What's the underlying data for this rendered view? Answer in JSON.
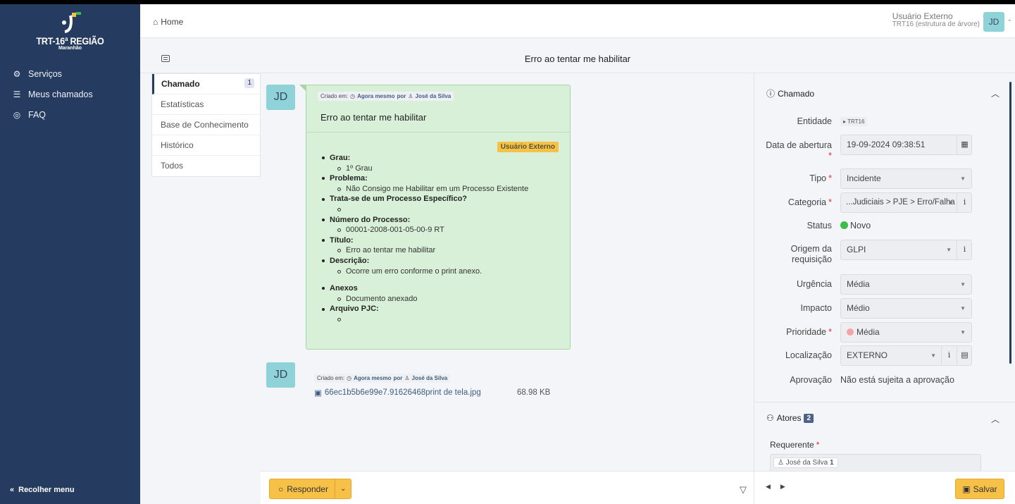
{
  "brand": {
    "title": "TRT-16ª REGIÃO",
    "subtitle": "Maranhão"
  },
  "sidebar": {
    "items": [
      {
        "label": "Serviços",
        "icon": "services-icon"
      },
      {
        "label": "Meus chamados",
        "icon": "list-icon"
      },
      {
        "label": "FAQ",
        "icon": "faq-icon"
      }
    ],
    "collapse_label": "Recolher menu"
  },
  "topbar": {
    "home_label": "Home",
    "user_name": "Usuário Externo",
    "user_entity": "TRT16 (estrutura de árvore)",
    "avatar_initials": "JD"
  },
  "ticket": {
    "title": "Erro ao tentar me habilitar"
  },
  "tabs": [
    {
      "label": "Chamado",
      "badge": "1"
    },
    {
      "label": "Estatísticas"
    },
    {
      "label": "Base de Conhecimento"
    },
    {
      "label": "Histórico"
    },
    {
      "label": "Todos"
    }
  ],
  "timeline": {
    "item1": {
      "avatar": "JD",
      "created_label": "Criado em:",
      "created_when": "Agora mesmo",
      "by_label": "por",
      "author": "José da Silva",
      "title": "Erro ao tentar me habilitar",
      "tag": "Usuário Externo",
      "fields": [
        {
          "key": "Grau:",
          "value": "1º Grau"
        },
        {
          "key": "Problema:",
          "value": "Não Consigo me Habilitar em um Processo Existente"
        },
        {
          "key": "Trata-se de um Processo Específico?",
          "value": ""
        },
        {
          "key": "Número do Processo:",
          "value": "00001-2008-001-05-00-9 RT"
        },
        {
          "key": "Título:",
          "value": "Erro ao tentar me habilitar"
        },
        {
          "key": "Descrição:",
          "value": "Ocorre um erro conforme o print anexo."
        },
        {
          "key": "Anexos",
          "value": "Documento anexado"
        },
        {
          "key": "Arquivo PJC:",
          "value": ""
        }
      ]
    },
    "item2": {
      "avatar": "JD",
      "created_label": "Criado em:",
      "created_when": "Agora mesmo",
      "by_label": "por",
      "author": "José da Silva",
      "file_name": "66ec1b5b6e99e7.91626468print de tela.jpg",
      "file_size": "68.98 KB"
    }
  },
  "footer": {
    "reply_label": "Responder",
    "save_label": "Salvar"
  },
  "panel": {
    "chamado_title": "Chamado",
    "entidade_label": "Entidade",
    "entidade_value": "TRT16",
    "data_label": "Data de abertura",
    "data_value": "19-09-2024 09:38:51",
    "tipo_label": "Tipo",
    "tipo_value": "Incidente",
    "categoria_label": "Categoria",
    "categoria_value": "...Judiciais > PJE > Erro/Falha",
    "status_label": "Status",
    "status_value": "Novo",
    "origem_label_1": "Origem da",
    "origem_label_2": "requisição",
    "origem_value": "GLPI",
    "urgencia_label": "Urgência",
    "urgencia_value": "Média",
    "impacto_label": "Impacto",
    "impacto_value": "Médio",
    "prioridade_label": "Prioridade",
    "prioridade_value": "Média",
    "localizacao_label": "Localização",
    "localizacao_value": "EXTERNO",
    "aprovacao_label": "Aprovação",
    "aprovacao_value": "Não está sujeita a aprovação",
    "atores_title": "Atores",
    "atores_count": "2",
    "requerente_label": "Requerente",
    "requerente_value": "José da Silva",
    "requerente_count": "1"
  },
  "colors": {
    "sidebar": "#253b5f",
    "accent": "#f7c148",
    "bubble": "#d8f0d8",
    "avatar": "#8fd3d8",
    "status_new": "#3bbd4b",
    "priority_medium": "#f6a3a3"
  }
}
